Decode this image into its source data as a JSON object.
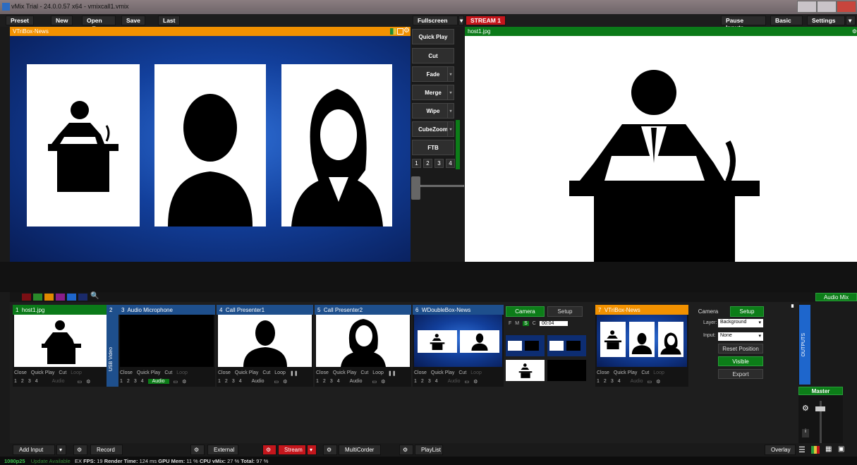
{
  "window": {
    "title": "vMix Trial - 24.0.0.57 x64 - vmixcall1.vmix"
  },
  "menu": {
    "preset": "Preset",
    "new": "New",
    "open": "Open",
    "save": "Save",
    "last": "Last",
    "fullscreen": "Fullscreen",
    "stream": "STREAM 1",
    "pause_inputs": "Pause Inputs",
    "basic": "Basic",
    "settings": "Settings"
  },
  "preview": {
    "title": "VTriBox-News"
  },
  "output": {
    "title": "host1.jpg"
  },
  "transitions": {
    "quick_play": "Quick Play",
    "cut": "Cut",
    "fade": "Fade",
    "merge": "Merge",
    "wipe": "Wipe",
    "cubezoom": "CubeZoom",
    "ftb": "FTB",
    "nums": [
      "1",
      "2",
      "3",
      "4"
    ]
  },
  "colors": {
    "orange": "#f29100",
    "green": "#0b7a19",
    "blue": "#1e4f8c",
    "red": "#c4161c"
  },
  "inputs": [
    {
      "num": "1",
      "name": "host1.jpg"
    },
    {
      "num": "2",
      "name": ""
    },
    {
      "num": "3",
      "name": "Audio Microphone"
    },
    {
      "num": "4",
      "name": "Call Presenter1"
    },
    {
      "num": "5",
      "name": "Call Presenter2"
    },
    {
      "num": "6",
      "name": "WDoubleBox-News"
    },
    {
      "num": "7",
      "name": "VTriBox-News"
    }
  ],
  "tile_controls": {
    "close": "Close",
    "quick_play": "Quick Play",
    "cut": "Cut",
    "loop": "Loop",
    "audio": "Audio",
    "nums": [
      "1",
      "2",
      "3",
      "4"
    ]
  },
  "usb_video": "USB Video",
  "camera_panel": {
    "camera": "Camera",
    "setup": "Setup",
    "f": "F",
    "m": "M",
    "s": "S",
    "c": "C",
    "time": "00:04"
  },
  "layer_panel": {
    "camera": "Camera",
    "setup": "Setup",
    "layer_label": "Layer:",
    "layer_value": "Background",
    "input_label": "Input:",
    "input_value": "None",
    "reset": "Reset Position",
    "visible": "Visible",
    "export": "Export"
  },
  "outputs_label": "OUTPUTS",
  "audio_mixer": "Audio Mix",
  "master": "Master",
  "bottom": {
    "add_input": "Add Input",
    "record": "Record",
    "external": "External",
    "stream": "Stream",
    "multicorder": "MultiCorder",
    "playlist": "PlayList",
    "overlay": "Overlay"
  },
  "status": {
    "res": "1080p25",
    "update": "Update Available",
    "ex": "EX",
    "fps_label": "FPS:",
    "fps": "19",
    "render_label": "Render Time:",
    "render": "124 ms",
    "gpu_label": "GPU Mem:",
    "gpu": "11 %",
    "cpu_label": "CPU vMix:",
    "cpu": "27 %",
    "total_label": "Total:",
    "total": "97 %"
  }
}
